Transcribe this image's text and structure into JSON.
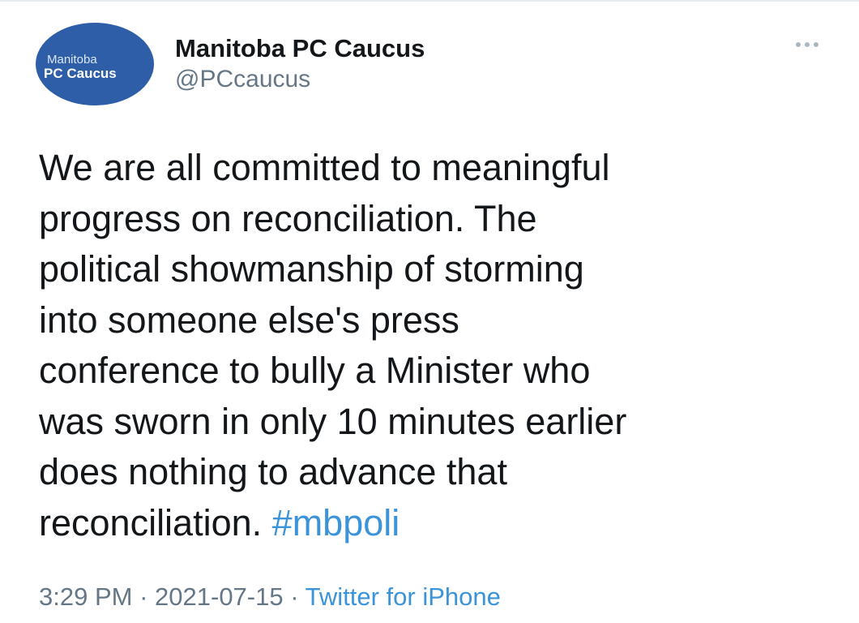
{
  "tweet": {
    "avatar": {
      "line1": "Manitoba",
      "line2": "PC Caucus",
      "bg_color": "#2e5ea8"
    },
    "display_name": "Manitoba PC Caucus",
    "handle": "@PCcaucus",
    "more_icon": "more-dots-icon",
    "text_lines": [
      "We are all committed to meaningful",
      "progress on reconciliation. The",
      "political showmanship of storming",
      "into someone else's press",
      "conference to bully a Minister who",
      "was sworn in only 10 minutes earlier",
      "does nothing to advance that",
      "reconciliation."
    ],
    "hashtag": "#mbpoli",
    "time": "3:29 PM",
    "date": "2021-07-15",
    "separator": "·",
    "source": "Twitter for iPhone",
    "link_color": "#3b94d9"
  }
}
